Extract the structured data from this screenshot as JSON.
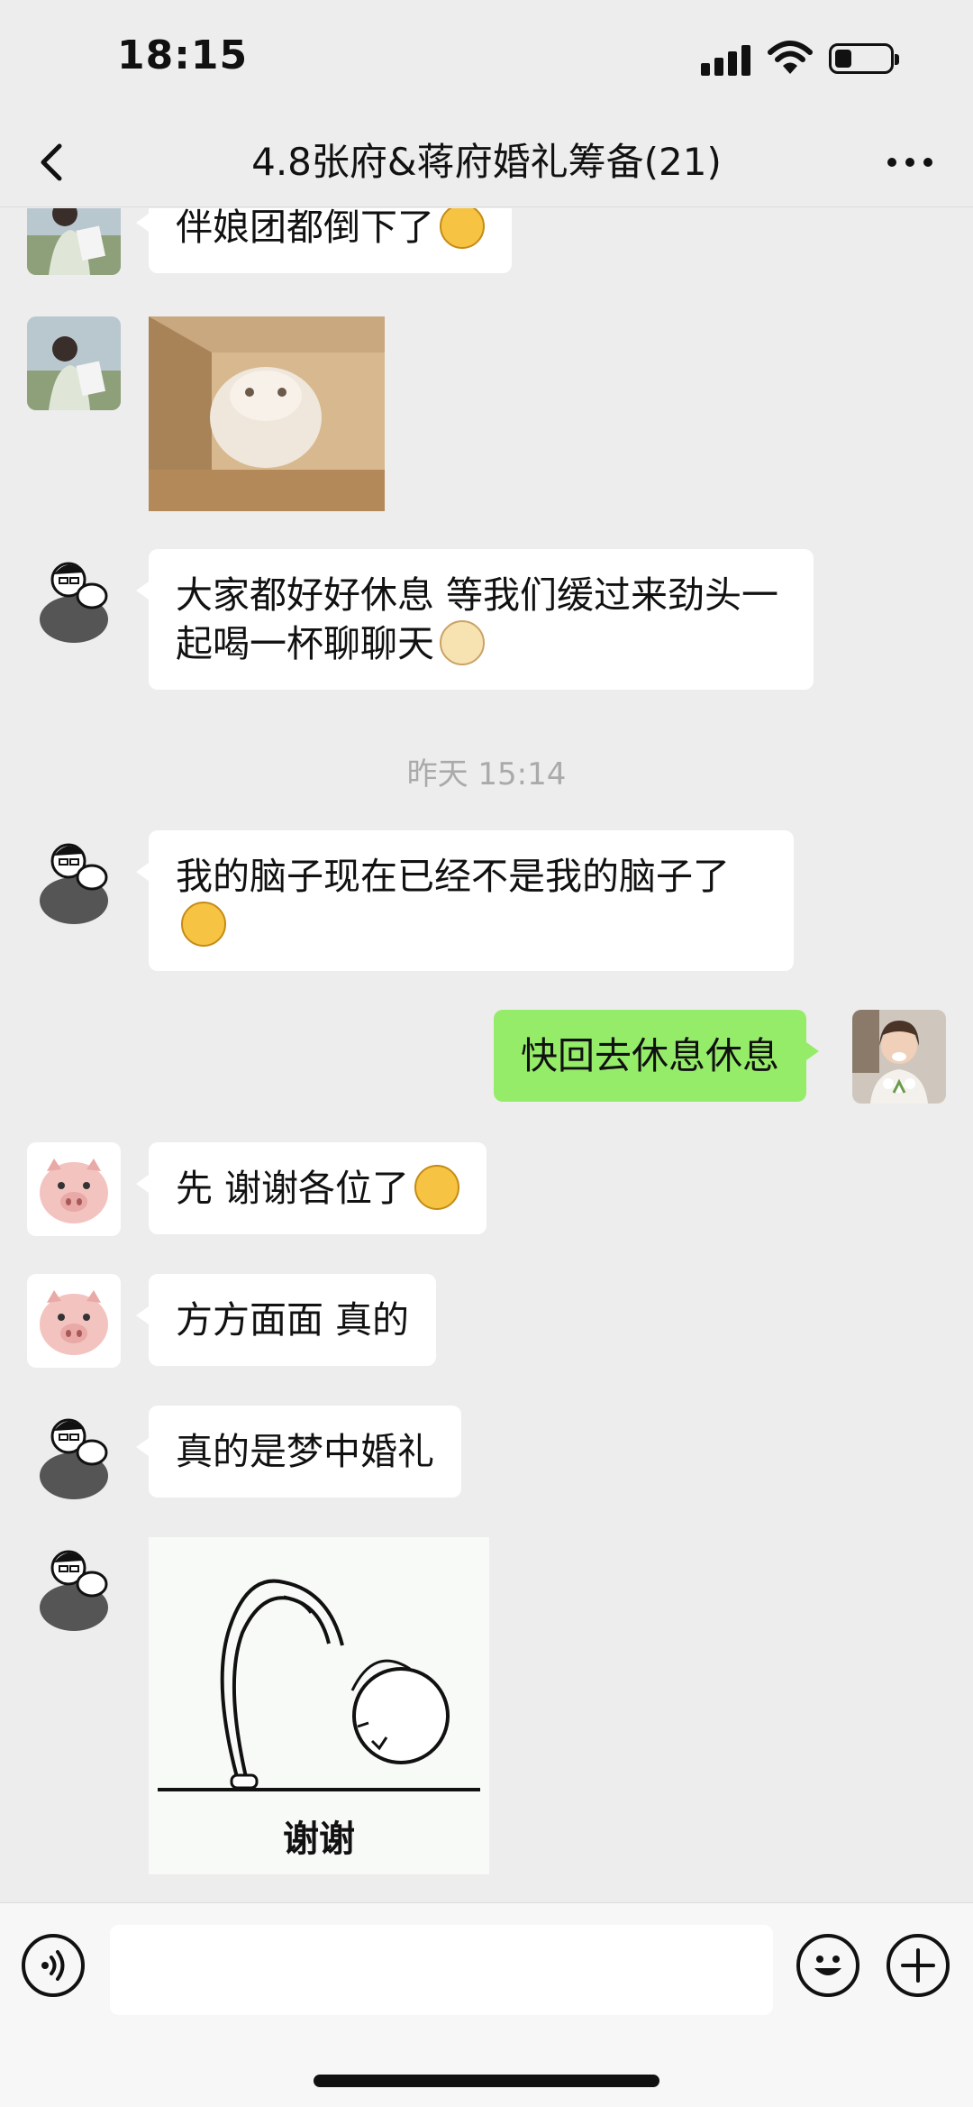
{
  "status_bar": {
    "time": "18:15"
  },
  "header": {
    "title": "4.8张府&蒋府婚礼筹备(21)"
  },
  "messages": [
    {
      "side": "left",
      "sender_avatar": "woman-outdoor-avatar",
      "text": "伴娘团都倒下了",
      "emoji": "face-with-zipper-emoji"
    },
    {
      "side": "left",
      "sender_avatar": "woman-outdoor-avatar",
      "sticker": "hamster-in-corner-sticker"
    },
    {
      "side": "left",
      "sender_avatar": "cartoon-man-avatar",
      "text": "大家都好好休息 等我们缓过来劲头一起喝一杯聊聊天",
      "emoji": "doge-emoji"
    },
    {
      "side": "left",
      "sender_avatar": "cartoon-man-avatar",
      "text": "我的脑子现在已经不是我的脑子了",
      "emoji": "teary-face-emoji"
    },
    {
      "side": "right",
      "sender_avatar": "smiling-woman-avatar",
      "text": "快回去休息休息"
    },
    {
      "side": "left",
      "sender_avatar": "pig-avatar",
      "text": "先 谢谢各位了",
      "emoji": "teary-face-emoji"
    },
    {
      "side": "left",
      "sender_avatar": "pig-avatar",
      "text": "方方面面 真的"
    },
    {
      "side": "left",
      "sender_avatar": "cartoon-man-avatar",
      "text": "真的是梦中婚礼"
    },
    {
      "side": "left",
      "sender_avatar": "cartoon-man-avatar",
      "sticker": "bowing-figure-thanks-sticker",
      "sticker_caption": "谢谢"
    }
  ],
  "timestamp_divider": "昨天 15:14",
  "input_bar": {
    "placeholder": ""
  },
  "colors": {
    "background": "#ededed",
    "my_bubble": "#95ec69",
    "other_bubble": "#ffffff",
    "timestamp": "#aaaaaa"
  }
}
